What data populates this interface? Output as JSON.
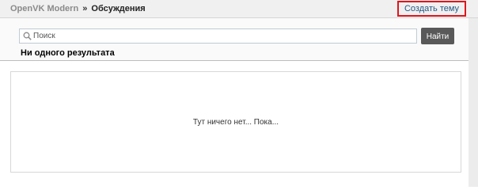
{
  "header": {
    "breadcrumb_root": "OpenVK Modern",
    "breadcrumb_separator": "»",
    "breadcrumb_current": "Обсуждения",
    "create_topic_label": "Создать тему"
  },
  "search": {
    "placeholder": "Поиск",
    "value": "",
    "button_label": "Найти",
    "results_text": "Ни одного результата"
  },
  "content": {
    "empty_message": "Тут ничего нет... Пока..."
  },
  "colors": {
    "highlight_border": "#e0151b",
    "link": "#2a5885",
    "button_bg": "#595959"
  }
}
